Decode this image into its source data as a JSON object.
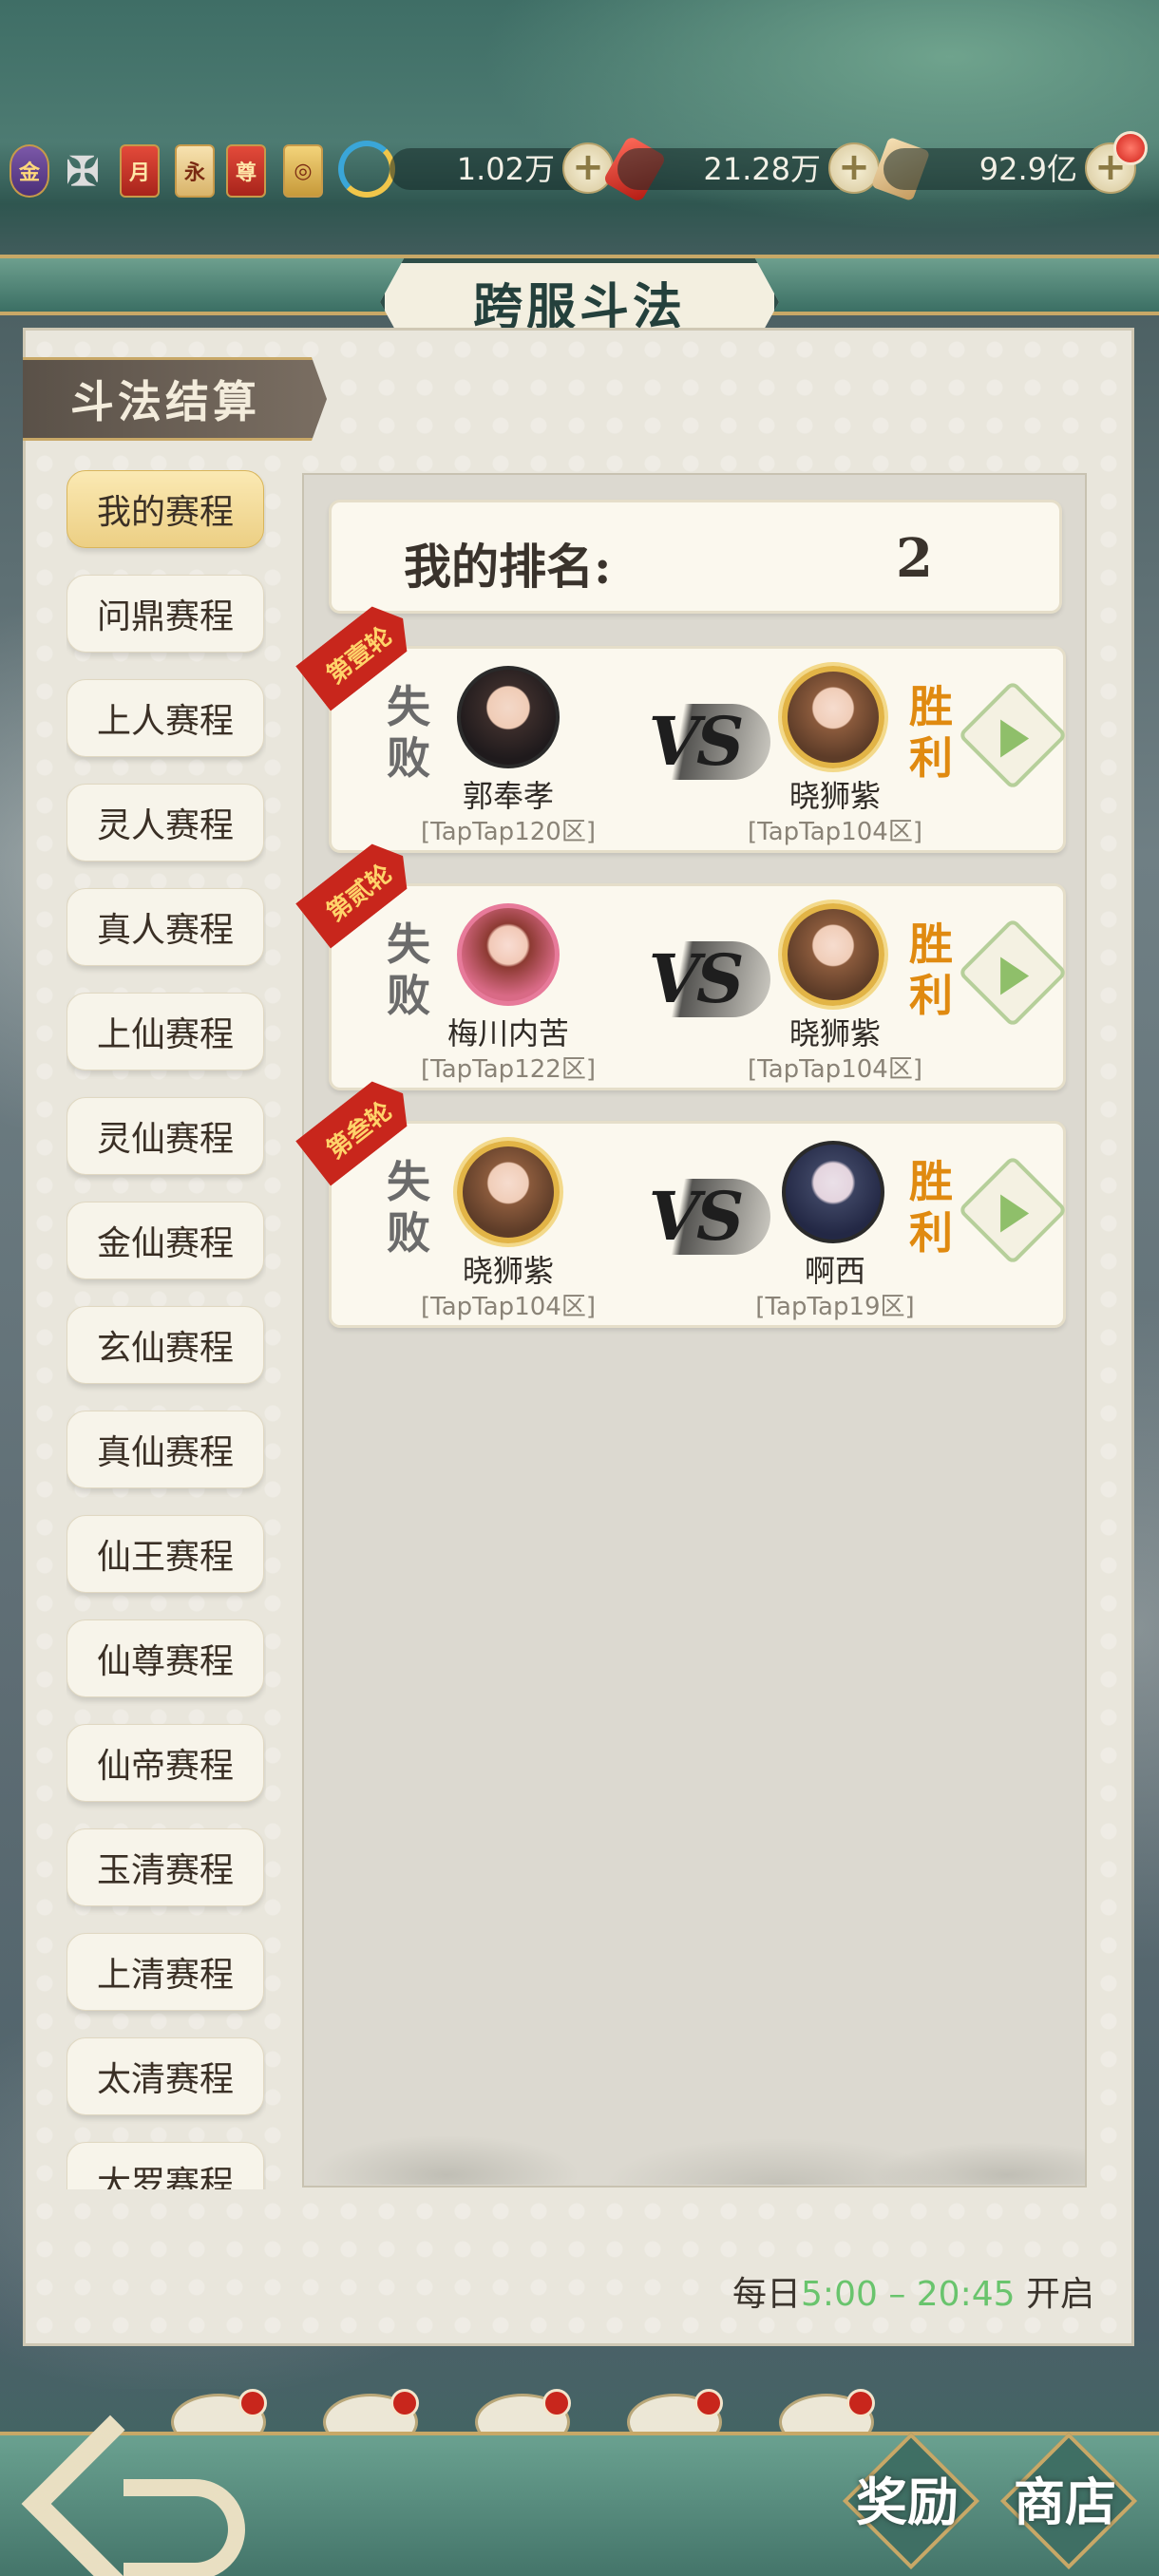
{
  "topbar": {
    "icons": [
      {
        "name": "gold-badge-icon",
        "glyph": "金"
      },
      {
        "name": "silver-emblem-icon",
        "glyph": "✠"
      },
      {
        "name": "monthly-card-icon",
        "glyph": "月"
      },
      {
        "name": "permanent-card-icon",
        "glyph": "永"
      },
      {
        "name": "honor-card-icon",
        "glyph": "尊"
      },
      {
        "name": "coin-scroll-icon",
        "glyph": "◎"
      }
    ],
    "resources": [
      {
        "name": "spirit-stones",
        "value": "1.02万"
      },
      {
        "name": "red-gems",
        "value": "21.28万"
      },
      {
        "name": "coins",
        "value": "92.9亿"
      }
    ]
  },
  "header": {
    "title": "跨服斗法"
  },
  "section": {
    "label": "斗法结算"
  },
  "menu": {
    "items": [
      {
        "label": "我的赛程",
        "active": true
      },
      {
        "label": "问鼎赛程"
      },
      {
        "label": "上人赛程"
      },
      {
        "label": "灵人赛程"
      },
      {
        "label": "真人赛程"
      },
      {
        "label": "上仙赛程"
      },
      {
        "label": "灵仙赛程"
      },
      {
        "label": "金仙赛程"
      },
      {
        "label": "玄仙赛程"
      },
      {
        "label": "真仙赛程"
      },
      {
        "label": "仙王赛程"
      },
      {
        "label": "仙尊赛程"
      },
      {
        "label": "仙帝赛程"
      },
      {
        "label": "玉清赛程"
      },
      {
        "label": "上清赛程"
      },
      {
        "label": "太清赛程"
      },
      {
        "label": "大罗赛程"
      }
    ]
  },
  "rank": {
    "label": "我的排名:",
    "value": "2"
  },
  "vs_label": "VS",
  "matches": [
    {
      "round": "第壹轮",
      "left_result": "失败",
      "right_result": "胜利",
      "left": {
        "name": "郭奉孝",
        "server": "[TapTap120区]"
      },
      "right": {
        "name": "晓狮紫",
        "server": "[TapTap104区]"
      }
    },
    {
      "round": "第贰轮",
      "left_result": "失败",
      "right_result": "胜利",
      "left": {
        "name": "梅川内苦",
        "server": "[TapTap122区]"
      },
      "right": {
        "name": "晓狮紫",
        "server": "[TapTap104区]"
      }
    },
    {
      "round": "第叁轮",
      "left_result": "失败",
      "right_result": "胜利",
      "left": {
        "name": "晓狮紫",
        "server": "[TapTap104区]"
      },
      "right": {
        "name": "啊西",
        "server": "[TapTap19区]"
      }
    }
  ],
  "schedule": {
    "prefix": "每日",
    "start": "5:00",
    "dash": "–",
    "end": "20:45",
    "suffix": "开启"
  },
  "bottom": {
    "reward_label": "奖励",
    "shop_label": "商店"
  }
}
